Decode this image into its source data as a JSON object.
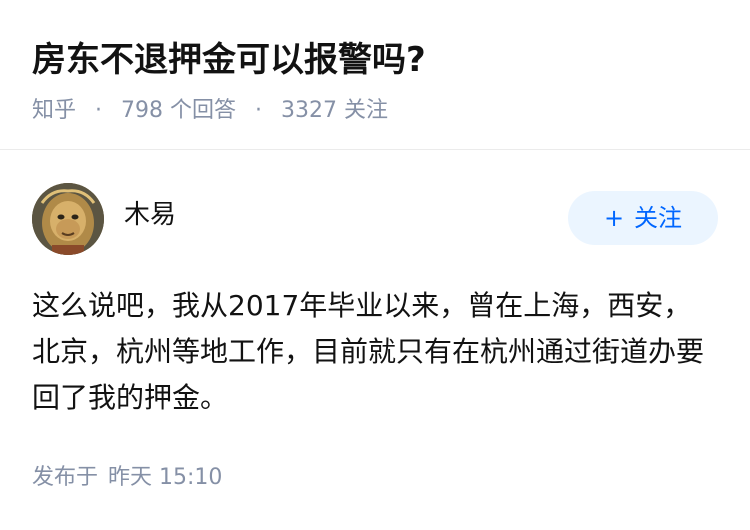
{
  "question": {
    "title": "房东不退押金可以报警吗?",
    "source": "知乎",
    "separator": "·",
    "answer_count": "798",
    "answer_label": "个回答",
    "follow_count": "3327",
    "follow_label": "关注"
  },
  "answer": {
    "author_name": "木易",
    "follow_button_plus": "+",
    "follow_button_label": "关注",
    "content": "这么说吧，我从2017年毕业以来，曾在上海，西安，北京，杭州等地工作，目前就只有在杭州通过街道办要回了我的押金。",
    "published_prefix": "发布于",
    "published_time": "昨天 15:10"
  },
  "colors": {
    "accent": "#0066ff",
    "follow_button_bg": "#ebf5ff",
    "meta_text": "#8590a6",
    "divider": "#ebebeb"
  }
}
